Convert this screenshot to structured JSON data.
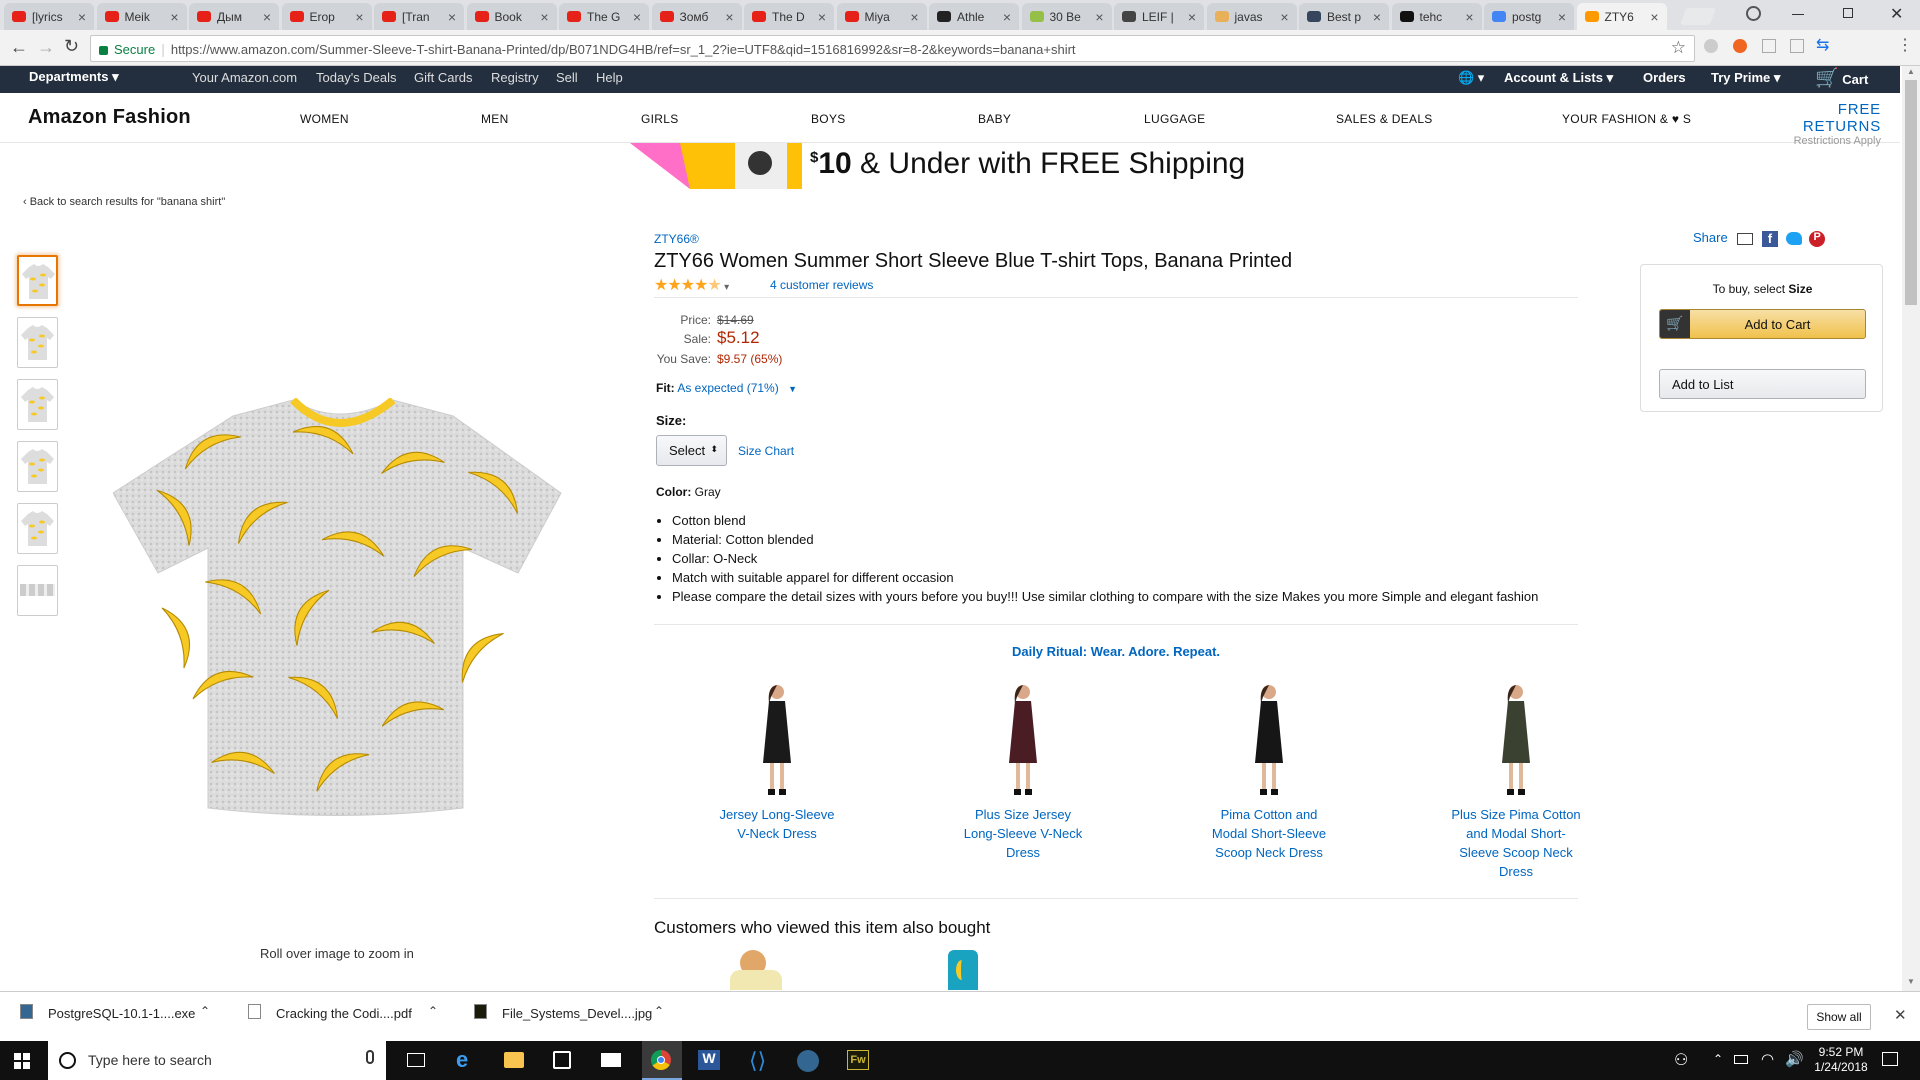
{
  "browser": {
    "tabs": [
      "[lyrics",
      "Meik",
      "Дым",
      "Erop",
      "[Tran",
      "Book",
      "The G",
      "Зомб",
      "The D",
      "Miya",
      "Athle",
      "30 Be",
      "LEIF |",
      "javas",
      "Best p",
      "tehc",
      "postg",
      "ZTY6"
    ],
    "secure_label": "Secure",
    "url": "https://www.amazon.com/Summer-Sleeve-T-shirt-Banana-Printed/dp/B071NDG4HB/ref=sr_1_2?ie=UTF8&qid=1516816992&sr=8-2&keywords=banana+shirt"
  },
  "nav": {
    "departments": "Departments",
    "links": [
      "Your Amazon.com",
      "Today's Deals",
      "Gift Cards",
      "Registry",
      "Sell",
      "Help"
    ],
    "account": "Account & Lists",
    "orders": "Orders",
    "prime": "Try Prime",
    "cart": "Cart",
    "cart_count": "0"
  },
  "fashion": {
    "brand": "Amazon Fashion",
    "categories": [
      "WOMEN",
      "MEN",
      "GIRLS",
      "BOYS",
      "BABY",
      "LUGGAGE",
      "SALES & DEALS",
      "YOUR FASHION & ♥ S"
    ],
    "free_returns": "FREE RETURNS",
    "restrictions": "Restrictions Apply"
  },
  "banner": {
    "price_symbol": "$",
    "amount": "10",
    "text": " & Under with FREE Shipping"
  },
  "product": {
    "back_link": "‹ Back to search results for \"banana shirt\"",
    "brand": "ZTY66®",
    "title": "ZTY66 Women Summer Short Sleeve Blue T-shirt Tops, Banana Printed",
    "reviews": "4 customer reviews",
    "rating": 4.5,
    "price_label": "Price:",
    "price": "$14.69",
    "sale_label": "Sale:",
    "sale": "$5.12",
    "save_label": "You Save:",
    "save": "$9.57 (65%)",
    "fit_label": "Fit:",
    "fit_value": "As expected (71%)",
    "size_label": "Size:",
    "size_select": "Select",
    "size_chart": "Size Chart",
    "color_label": "Color:",
    "color_value": "Gray",
    "bullets": [
      "Cotton blend",
      "Material: Cotton blended",
      "Collar: O-Neck",
      "Match with suitable apparel for different occasion",
      "Please compare the detail sizes with yours before you buy!!! Use similar clothing to compare with the size Makes you more Simple and elegant fashion"
    ],
    "roll_over": "Roll over image to zoom in",
    "share": "Share"
  },
  "buybox": {
    "to_buy": "To buy, select ",
    "to_buy_bold": "Size",
    "add_to_cart": "Add to Cart",
    "add_to_list": "Add to List"
  },
  "ritual": {
    "heading": "Daily Ritual: Wear. Adore. Repeat.",
    "dresses": [
      {
        "name": "Jersey Long-Sleeve V-Neck Dress",
        "color": "#1a1a1a"
      },
      {
        "name": "Plus Size Jersey Long-Sleeve V-Neck Dress",
        "color": "#4a1c24"
      },
      {
        "name": "Pima Cotton and Modal Short-Sleeve Scoop Neck Dress",
        "color": "#161616"
      },
      {
        "name": "Plus Size Pima Cotton and Modal Short-Sleeve Scoop Neck Dress",
        "color": "#3a4130"
      }
    ]
  },
  "also_bought": {
    "heading": "Customers who viewed this item also bought"
  },
  "downloads": {
    "items": [
      "PostgreSQL-10.1-1....exe",
      "Cracking the Codi....pdf",
      "File_Systems_Devel....jpg"
    ],
    "show_all": "Show all"
  },
  "taskbar": {
    "search_placeholder": "Type here to search",
    "time": "9:52 PM",
    "date": "1/24/2018"
  },
  "colors": {
    "nav_bg": "#232f3e",
    "link": "#0066c0",
    "price_red": "#b12704",
    "banana_yellow": "#f7c924"
  }
}
